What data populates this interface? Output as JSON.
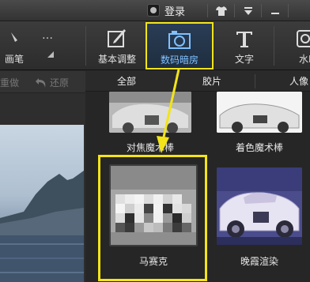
{
  "titlebar": {
    "login_label": "登录",
    "buttons": [
      "shirt-icon",
      "menu-icon",
      "minimize-icon"
    ]
  },
  "toolbar": {
    "brush_label": "画笔",
    "more_label": "…",
    "items": [
      {
        "label": "基本调整",
        "icon": "adjust-icon"
      },
      {
        "label": "数码暗房",
        "icon": "camera-icon",
        "active": true
      },
      {
        "label": "文字",
        "icon": "text-icon"
      },
      {
        "label": "水印",
        "icon": "watermark-icon"
      }
    ]
  },
  "subbar": {
    "redo_label": "重做",
    "undo_label": "还原"
  },
  "tabs": [
    "全部",
    "胶片",
    "人像"
  ],
  "effects": [
    {
      "label": "对焦魔术棒"
    },
    {
      "label": "着色魔术棒"
    },
    {
      "label": "马赛克",
      "selected": true
    },
    {
      "label": "晚霞渲染"
    }
  ],
  "colors": {
    "highlight": "#f2e418",
    "active_text": "#7fc0ff"
  }
}
